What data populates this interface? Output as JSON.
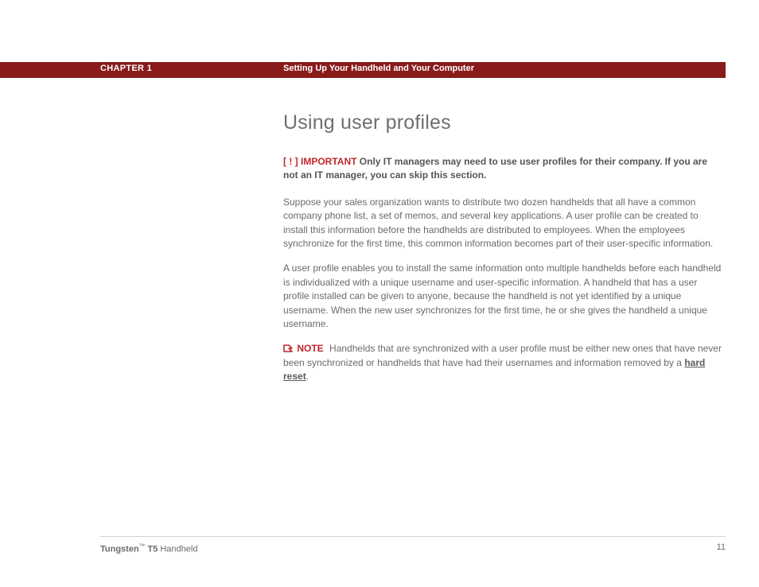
{
  "header": {
    "chapter": "CHAPTER 1",
    "section": "Setting Up Your Handheld and Your Computer"
  },
  "content": {
    "title": "Using user profiles",
    "important": {
      "bracket_open": "[",
      "bang": " ! ",
      "bracket_close": "]",
      "label": " IMPORTANT ",
      "text": " Only IT managers may need to use user profiles for their company. If you are not an IT manager, you can skip this section."
    },
    "para1": "Suppose your sales organization wants to distribute two dozen handhelds that all have a common company phone list, a set of memos, and several key applications. A user profile can be created to install this information before the handhelds are distributed to employees. When the employees synchronize for the first time, this common information becomes part of their user-specific information.",
    "para2": "A user profile enables you to install the same information onto multiple handhelds before each handheld is individualized with a unique username and user-specific information. A handheld that has a user profile installed can be given to anyone, because the handheld is not yet identified by a unique username. When the new user synchronizes for the first time, he or she gives the handheld a unique username.",
    "note": {
      "label": "NOTE",
      "text_before": "Handhelds that are synchronized with a user profile must be either new ones that have never been synchronized or handhelds that have had their usernames and information removed by a ",
      "link": "hard reset",
      "text_after": "."
    }
  },
  "footer": {
    "brand_bold": "Tungsten",
    "tm": "™",
    "model_bold": " T5",
    "suffix": " Handheld",
    "page": "11"
  }
}
